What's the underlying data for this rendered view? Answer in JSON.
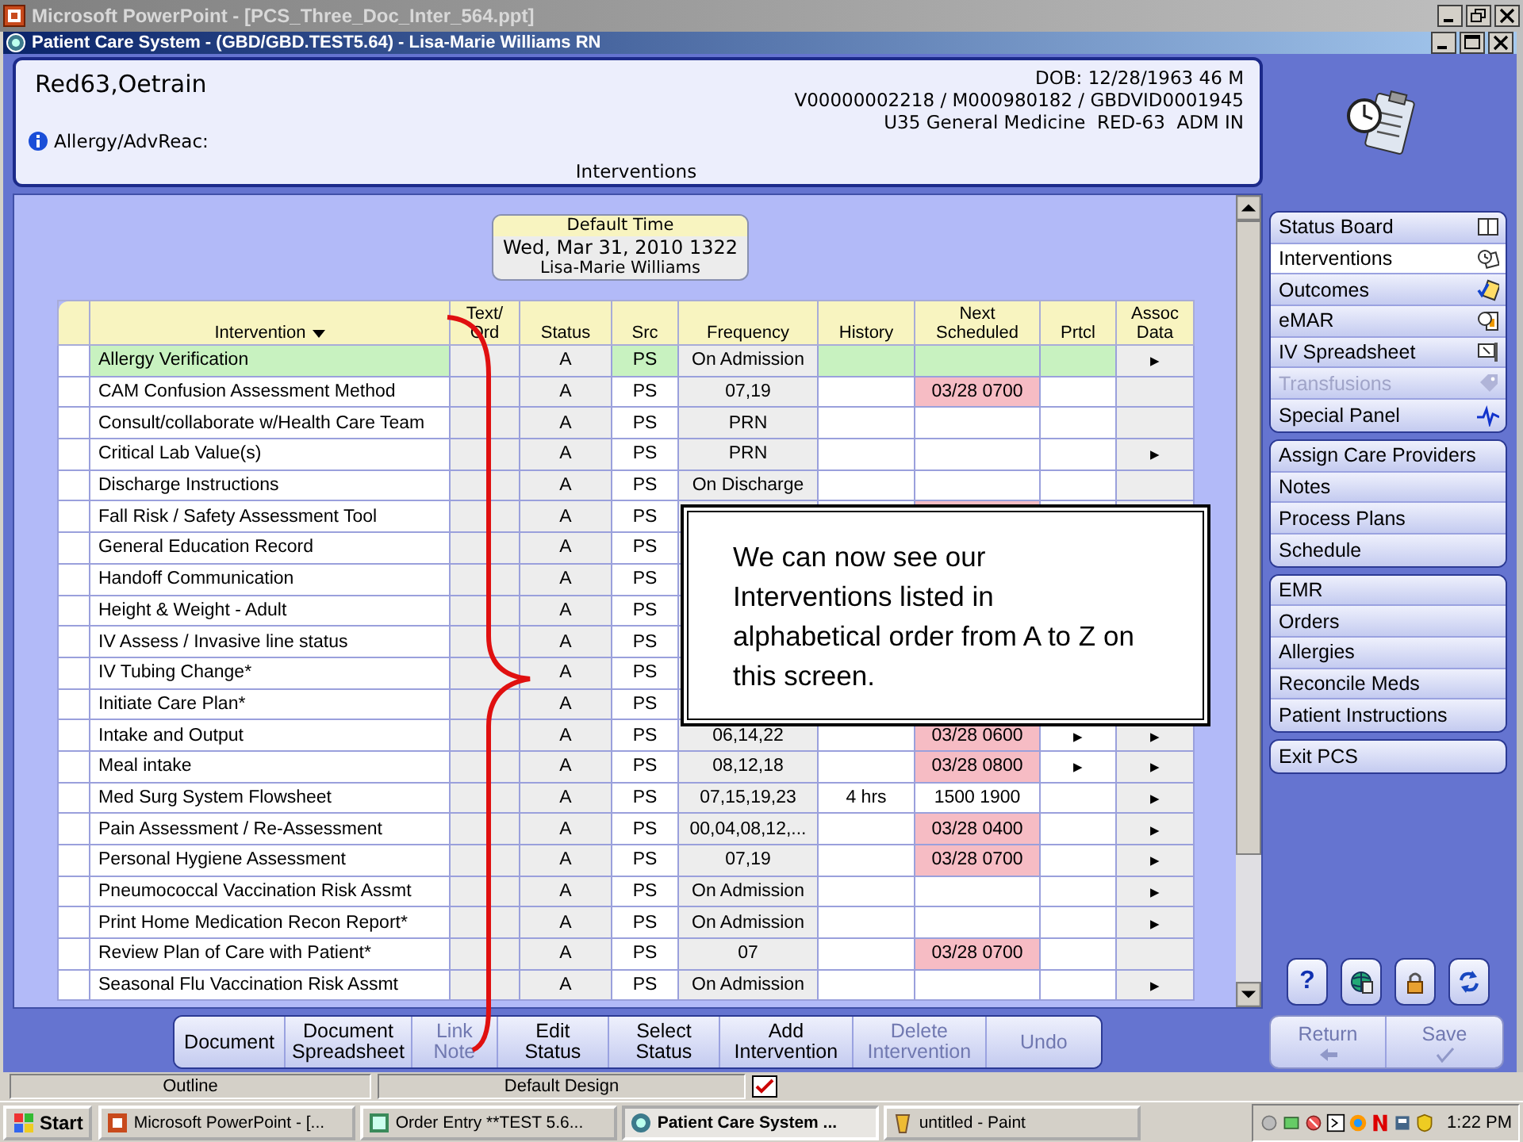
{
  "ppt_window": {
    "title": "Microsoft PowerPoint - [PCS_Three_Doc_Inter_564.ppt]"
  },
  "window": {
    "title": "Patient Care System - (GBD/GBD.TEST5.64) - Lisa-Marie Williams RN"
  },
  "patient": {
    "name": "Red63,Oetrain",
    "dob": "DOB: 12/28/1963 46 M",
    "ids": "V00000002218 / M000980182 / GBDVID0001945",
    "location": "U35 General Medicine  RED-63  ADM IN",
    "allergy_label": "Allergy/AdvReac:"
  },
  "section_title": "Interventions",
  "default_time": {
    "label": "Default Time",
    "datetime": "Wed, Mar 31, 2010  1322",
    "user": "Lisa-Marie Williams"
  },
  "table": {
    "columns": [
      {
        "label": "Intervention",
        "sorted": true
      },
      {
        "label": "Text/\nOrd",
        "sorted": false
      },
      {
        "label": "Status",
        "sorted": false
      },
      {
        "label": "Src",
        "sorted": false
      },
      {
        "label": "Frequency",
        "sorted": false
      },
      {
        "label": "History",
        "sorted": false
      },
      {
        "label": "Next\nScheduled",
        "sorted": false
      },
      {
        "label": "Prtcl",
        "sorted": false
      },
      {
        "label": "Assoc\nData",
        "sorted": false
      }
    ],
    "rows": [
      {
        "intervention": "Allergy Verification",
        "status": "A",
        "src": "PS",
        "frequency": "On Admission",
        "assoc": "▸",
        "overdue": false,
        "selected": true
      },
      {
        "intervention": "CAM Confusion Assessment Method",
        "status": "A",
        "src": "PS",
        "frequency": "07,19",
        "next_scheduled": "03/28 0700",
        "overdue": true,
        "selected": false
      },
      {
        "intervention": "Consult/collaborate w/Health Care Team",
        "status": "A",
        "src": "PS",
        "frequency": "PRN",
        "overdue": false,
        "selected": false
      },
      {
        "intervention": "Critical Lab Value(s)",
        "status": "A",
        "src": "PS",
        "frequency": "PRN",
        "assoc": "▸",
        "overdue": false,
        "selected": false
      },
      {
        "intervention": "Discharge Instructions",
        "status": "A",
        "src": "PS",
        "frequency": "On Discharge",
        "overdue": false,
        "selected": false
      },
      {
        "intervention": "Fall Risk / Safety Assessment Tool",
        "status": "A",
        "src": "PS",
        "overdue": true,
        "selected": false
      },
      {
        "intervention": "General Education Record",
        "status": "A",
        "src": "PS",
        "selected": false
      },
      {
        "intervention": "Handoff Communication",
        "status": "A",
        "src": "PS",
        "selected": false
      },
      {
        "intervention": "Height & Weight - Adult",
        "status": "A",
        "src": "PS",
        "selected": false
      },
      {
        "intervention": "IV Assess / Invasive line status",
        "status": "A",
        "src": "PS",
        "selected": false
      },
      {
        "intervention": "IV Tubing Change*",
        "status": "A",
        "src": "PS",
        "selected": false
      },
      {
        "intervention": "Initiate Care Plan*",
        "status": "A",
        "src": "PS",
        "selected": false
      },
      {
        "intervention": "Intake and Output",
        "status": "A",
        "src": "PS",
        "frequency": "06,14,22",
        "next_scheduled": "03/28 0600",
        "prtcl": "▸",
        "assoc": "▸",
        "overdue": true,
        "selected": false
      },
      {
        "intervention": "Meal intake",
        "status": "A",
        "src": "PS",
        "frequency": "08,12,18",
        "next_scheduled": "03/28 0800",
        "prtcl": "▸",
        "assoc": "▸",
        "overdue": true,
        "selected": false
      },
      {
        "intervention": "Med Surg System Flowsheet",
        "status": "A",
        "src": "PS",
        "frequency": "07,15,19,23",
        "history": "4 hrs",
        "next_scheduled": "1500 1900",
        "assoc": "▸",
        "overdue": false,
        "selected": false
      },
      {
        "intervention": "Pain Assessment / Re-Assessment",
        "status": "A",
        "src": "PS",
        "frequency": "00,04,08,12,...",
        "next_scheduled": "03/28 0400",
        "assoc": "▸",
        "overdue": true,
        "selected": false
      },
      {
        "intervention": "Personal Hygiene Assessment",
        "status": "A",
        "src": "PS",
        "frequency": "07,19",
        "next_scheduled": "03/28 0700",
        "assoc": "▸",
        "overdue": true,
        "selected": false
      },
      {
        "intervention": "Pneumococcal Vaccination Risk Assmt",
        "status": "A",
        "src": "PS",
        "frequency": "On Admission",
        "assoc": "▸",
        "overdue": false,
        "selected": false
      },
      {
        "intervention": "Print Home Medication Recon Report*",
        "status": "A",
        "src": "PS",
        "frequency": "On Admission",
        "assoc": "▸",
        "overdue": false,
        "selected": false
      },
      {
        "intervention": "Review Plan of Care with Patient*",
        "status": "A",
        "src": "PS",
        "frequency": "07",
        "next_scheduled": "03/28 0700",
        "overdue": true,
        "selected": false
      },
      {
        "intervention": "Seasonal Flu Vaccination Risk Assmt",
        "status": "A",
        "src": "PS",
        "frequency": "On Admission",
        "assoc": "▸",
        "overdue": false,
        "selected": false
      }
    ]
  },
  "callout": "We can now see our Interventions listed in alphabetical order from A to Z on this screen.",
  "nav_groups": [
    [
      {
        "label": "Status Board",
        "kind": "book",
        "selected": false,
        "disabled": false
      },
      {
        "label": "Interventions",
        "kind": "clock-note",
        "selected": true,
        "disabled": false
      },
      {
        "label": "Outcomes",
        "kind": "check-note",
        "selected": false,
        "disabled": false
      },
      {
        "label": "eMAR",
        "kind": "clock-sheet",
        "selected": false,
        "disabled": false
      },
      {
        "label": "IV Spreadsheet",
        "kind": "monitor",
        "selected": false,
        "disabled": false
      },
      {
        "label": "Transfusions",
        "kind": "tag",
        "selected": false,
        "disabled": true
      },
      {
        "label": "Special Panel",
        "kind": "pulse",
        "selected": false,
        "disabled": false
      }
    ],
    [
      {
        "label": "Assign Care Providers",
        "selected": false,
        "disabled": false
      },
      {
        "label": "Notes",
        "selected": false,
        "disabled": false
      },
      {
        "label": "Process Plans",
        "selected": false,
        "disabled": false
      },
      {
        "label": "Schedule",
        "selected": false,
        "disabled": false
      }
    ],
    [
      {
        "label": "EMR",
        "selected": false,
        "disabled": false
      },
      {
        "label": "Orders",
        "selected": false,
        "disabled": false
      },
      {
        "label": "Allergies",
        "selected": false,
        "disabled": false
      },
      {
        "label": "Reconcile Meds",
        "selected": false,
        "disabled": false
      },
      {
        "label": "Patient Instructions",
        "selected": false,
        "disabled": false
      }
    ],
    [
      {
        "label": "Exit PCS",
        "selected": false,
        "disabled": false
      }
    ]
  ],
  "nav_tools": [
    {
      "kind": "help",
      "label": "?"
    },
    {
      "kind": "globe"
    },
    {
      "kind": "lock"
    },
    {
      "kind": "refresh"
    }
  ],
  "toolbar": [
    {
      "label": "Document",
      "disabled": false
    },
    {
      "label": "Document\nSpreadsheet",
      "disabled": false
    },
    {
      "label": "Link\nNote",
      "disabled": true
    },
    {
      "label": "Edit\nStatus",
      "disabled": false
    },
    {
      "label": "Select\nStatus",
      "disabled": false
    },
    {
      "label": "Add\nIntervention",
      "disabled": false
    },
    {
      "label": "Delete\nIntervention",
      "disabled": true
    },
    {
      "label": "Undo",
      "disabled": true
    }
  ],
  "action_buttons": [
    {
      "label": "Return",
      "kind": "arrow",
      "disabled": true
    },
    {
      "label": "Save",
      "kind": "check",
      "disabled": true
    }
  ],
  "ppt_status": [
    "Outline",
    "Default Design"
  ],
  "taskbar": {
    "start": "Start",
    "tasks": [
      {
        "label": "Microsoft PowerPoint - [...",
        "selected": false
      },
      {
        "label": "Order Entry **TEST 5.6...",
        "selected": false
      },
      {
        "label": "Patient Care System ...",
        "selected": true
      },
      {
        "label": "untitled - Paint",
        "selected": false
      }
    ],
    "clock": "1:22 PM"
  }
}
